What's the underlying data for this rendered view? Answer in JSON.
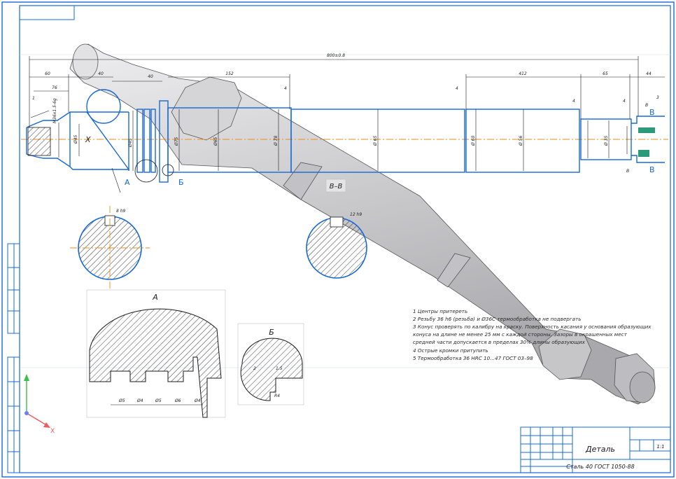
{
  "title_block": {
    "name": "Деталь",
    "material": "Сталь 40 ГОСТ 1050-88",
    "sheet_value": "1:1"
  },
  "section_labels": {
    "a": "А",
    "b": "Б",
    "v_view": "В",
    "vv_section": "В–В",
    "x_marker": "X"
  },
  "notes": [
    "1 Центры притереть",
    "2 Резьбу 36 h6 (резьба) и Ø36С термообработка не подвергать",
    "3 Конус проверять по калибру на краску. Поверхность касания у основания образующих",
    "конуса на длине не менее 25 мм с каждой стороны. Зазоры в окрашенных мест",
    "средней части допускается в пределах 30% длины образующих",
    "4 Острые кромки притупить",
    "5 Термообработка 36 НRС 10...47 ГОСТ 03–98"
  ],
  "dimensions": {
    "overall": "800±0.8",
    "d60": "60",
    "d40a": "40",
    "d40b": "40",
    "d152": "152",
    "d412": "412",
    "d65": "65",
    "d44": "44",
    "d4a": "4",
    "d4b": "4",
    "d4c": "4",
    "d4d": "4",
    "d76": "76",
    "d1": "1",
    "d3": "3",
    "thread": "M36x1.5-6g",
    "dia1": "Ø45",
    "dia2": "Ø45",
    "dia3": "Ø75",
    "dia4": "Ø65",
    "dia5": "Ø 78",
    "dia6": "Ø 65",
    "dia7": "Ø 60",
    "dia8": "Ø 56",
    "dia9": "Ø 35",
    "key1": "8 h9",
    "key2": "12 h9",
    "a1": "Ø5",
    "a2": "Ø4",
    "a3": "Ø5",
    "a4": "Ø6",
    "a5": "Ø4",
    "b1": "2",
    "b2": "1.5",
    "b3": "R4",
    "bb1": "0.5",
    "bb2": "0.25",
    "vlabel1": "В",
    "vlabel2": "В"
  },
  "triad": {
    "x": "X"
  },
  "colors": {
    "frame": "#1668d8",
    "axis": "#ef8a1a",
    "shaft": "#c9c9cb",
    "hatch": "#333333"
  }
}
